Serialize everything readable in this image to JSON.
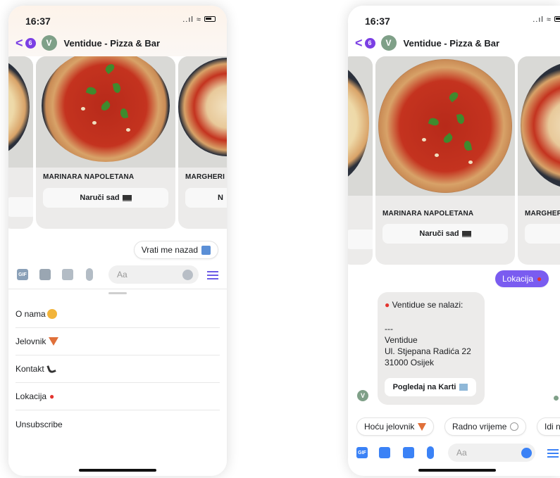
{
  "status": {
    "time": "16:37",
    "signal_icons": "..ıl ≈"
  },
  "header": {
    "back_glyph": "<",
    "unread_count": "6",
    "avatar_letter": "V",
    "title": "Ventidue - Pizza & Bar"
  },
  "cards": [
    {
      "title": "MARINARA NAPOLETANA",
      "button_label": "Naruči sad",
      "icon": "laptop-icon"
    },
    {
      "title": "MARGHERI",
      "button_label": "N"
    }
  ],
  "cards_b": [
    {
      "title": "MARINARA NAPOLETANA",
      "button_label": "Naruči sad",
      "icon": "laptop-icon"
    },
    {
      "title": "MARGHER"
    }
  ],
  "phone_a": {
    "reply_pill": "Vrati me nazad",
    "composer": {
      "gif_label": "GIF",
      "placeholder": "Aa"
    },
    "menu_items": [
      {
        "label": "O nama",
        "icon": "party-face-icon"
      },
      {
        "label": "Jelovnik",
        "icon": "pizza-icon"
      },
      {
        "label": "Kontakt",
        "icon": "phone-icon"
      },
      {
        "label": "Lokacija",
        "icon": "pin-icon"
      },
      {
        "label": "Unsubscribe"
      }
    ]
  },
  "phone_b": {
    "sent_message": "Lokacija",
    "location_bubble": {
      "heading": "Ventidue se nalazi:",
      "separator": "---",
      "name": "Ventidue",
      "street": "Ul. Stjepana Radića 22",
      "city": "31000 Osijek",
      "button_label": "Pogledaj na Karti"
    },
    "quick_replies": [
      {
        "label": "Hoću jelovnik",
        "icon": "pizza-icon"
      },
      {
        "label": "Radno vrijeme",
        "icon": "clock-icon"
      },
      {
        "label": "Idi n"
      }
    ],
    "composer": {
      "gif_label": "GIF",
      "placeholder": "Aa"
    }
  },
  "colors": {
    "accent": "#7b3fe4",
    "bubble_grey": "#ecebea",
    "sent_purple": "#7a5cf0",
    "composer_blue": "#3b82f6"
  }
}
